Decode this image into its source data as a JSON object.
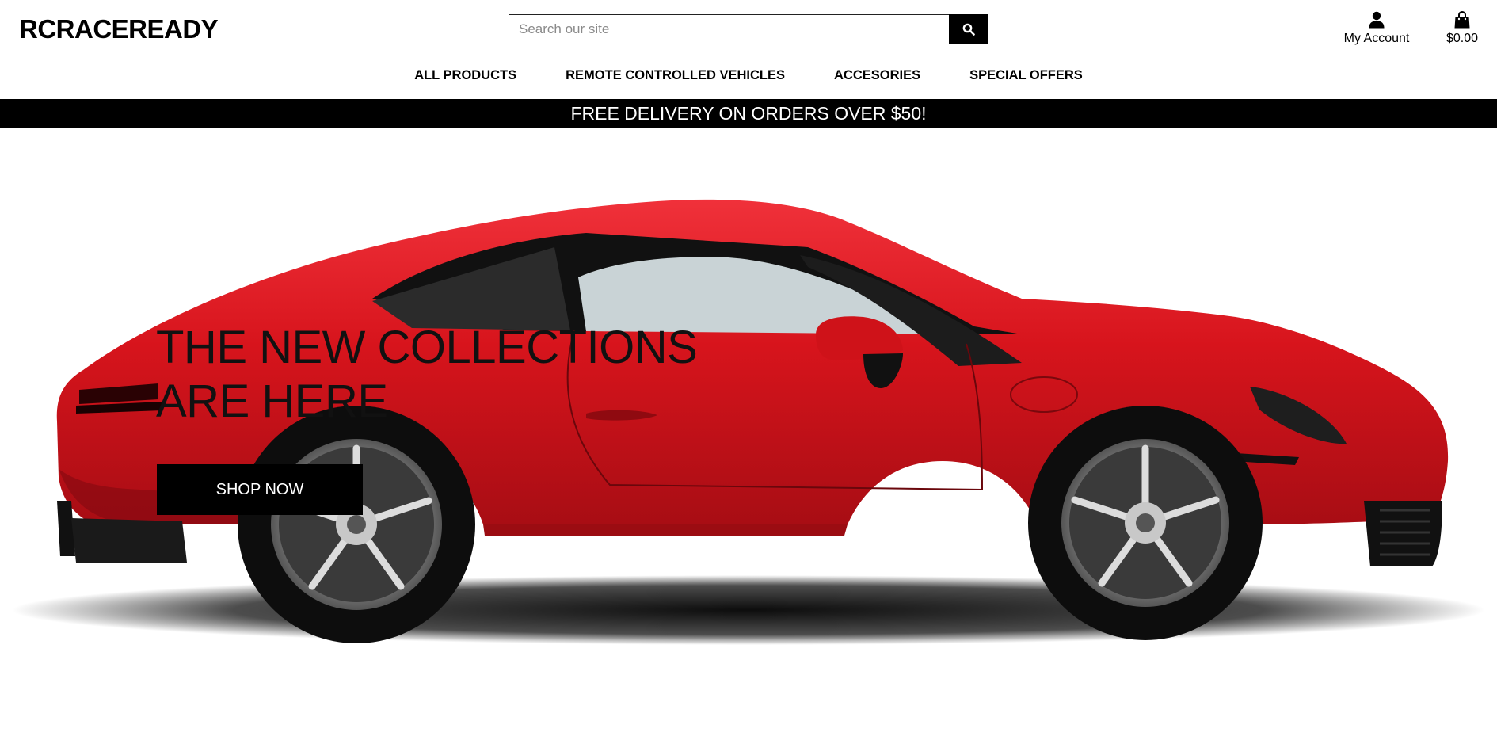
{
  "header": {
    "logo": "RCRACEREADY",
    "search": {
      "placeholder": "Search our site",
      "icon": "search-icon"
    },
    "account": {
      "label": "My Account",
      "icon": "user-icon"
    },
    "cart": {
      "total": "$0.00",
      "icon": "shopping-bag-icon"
    }
  },
  "nav": {
    "items": [
      {
        "label": "ALL PRODUCTS"
      },
      {
        "label": "REMOTE CONTROLLED VEHICLES"
      },
      {
        "label": "ACCESORIES"
      },
      {
        "label": "SPECIAL OFFERS"
      }
    ]
  },
  "banner": {
    "text": "FREE DELIVERY ON ORDERS OVER $50!"
  },
  "hero": {
    "title_line1": "THE NEW COLLECTIONS",
    "title_line2": "ARE HERE",
    "button_label": "SHOP NOW"
  },
  "colors": {
    "accent": "#000000",
    "car_red": "#d7141c",
    "background": "#ffffff"
  }
}
